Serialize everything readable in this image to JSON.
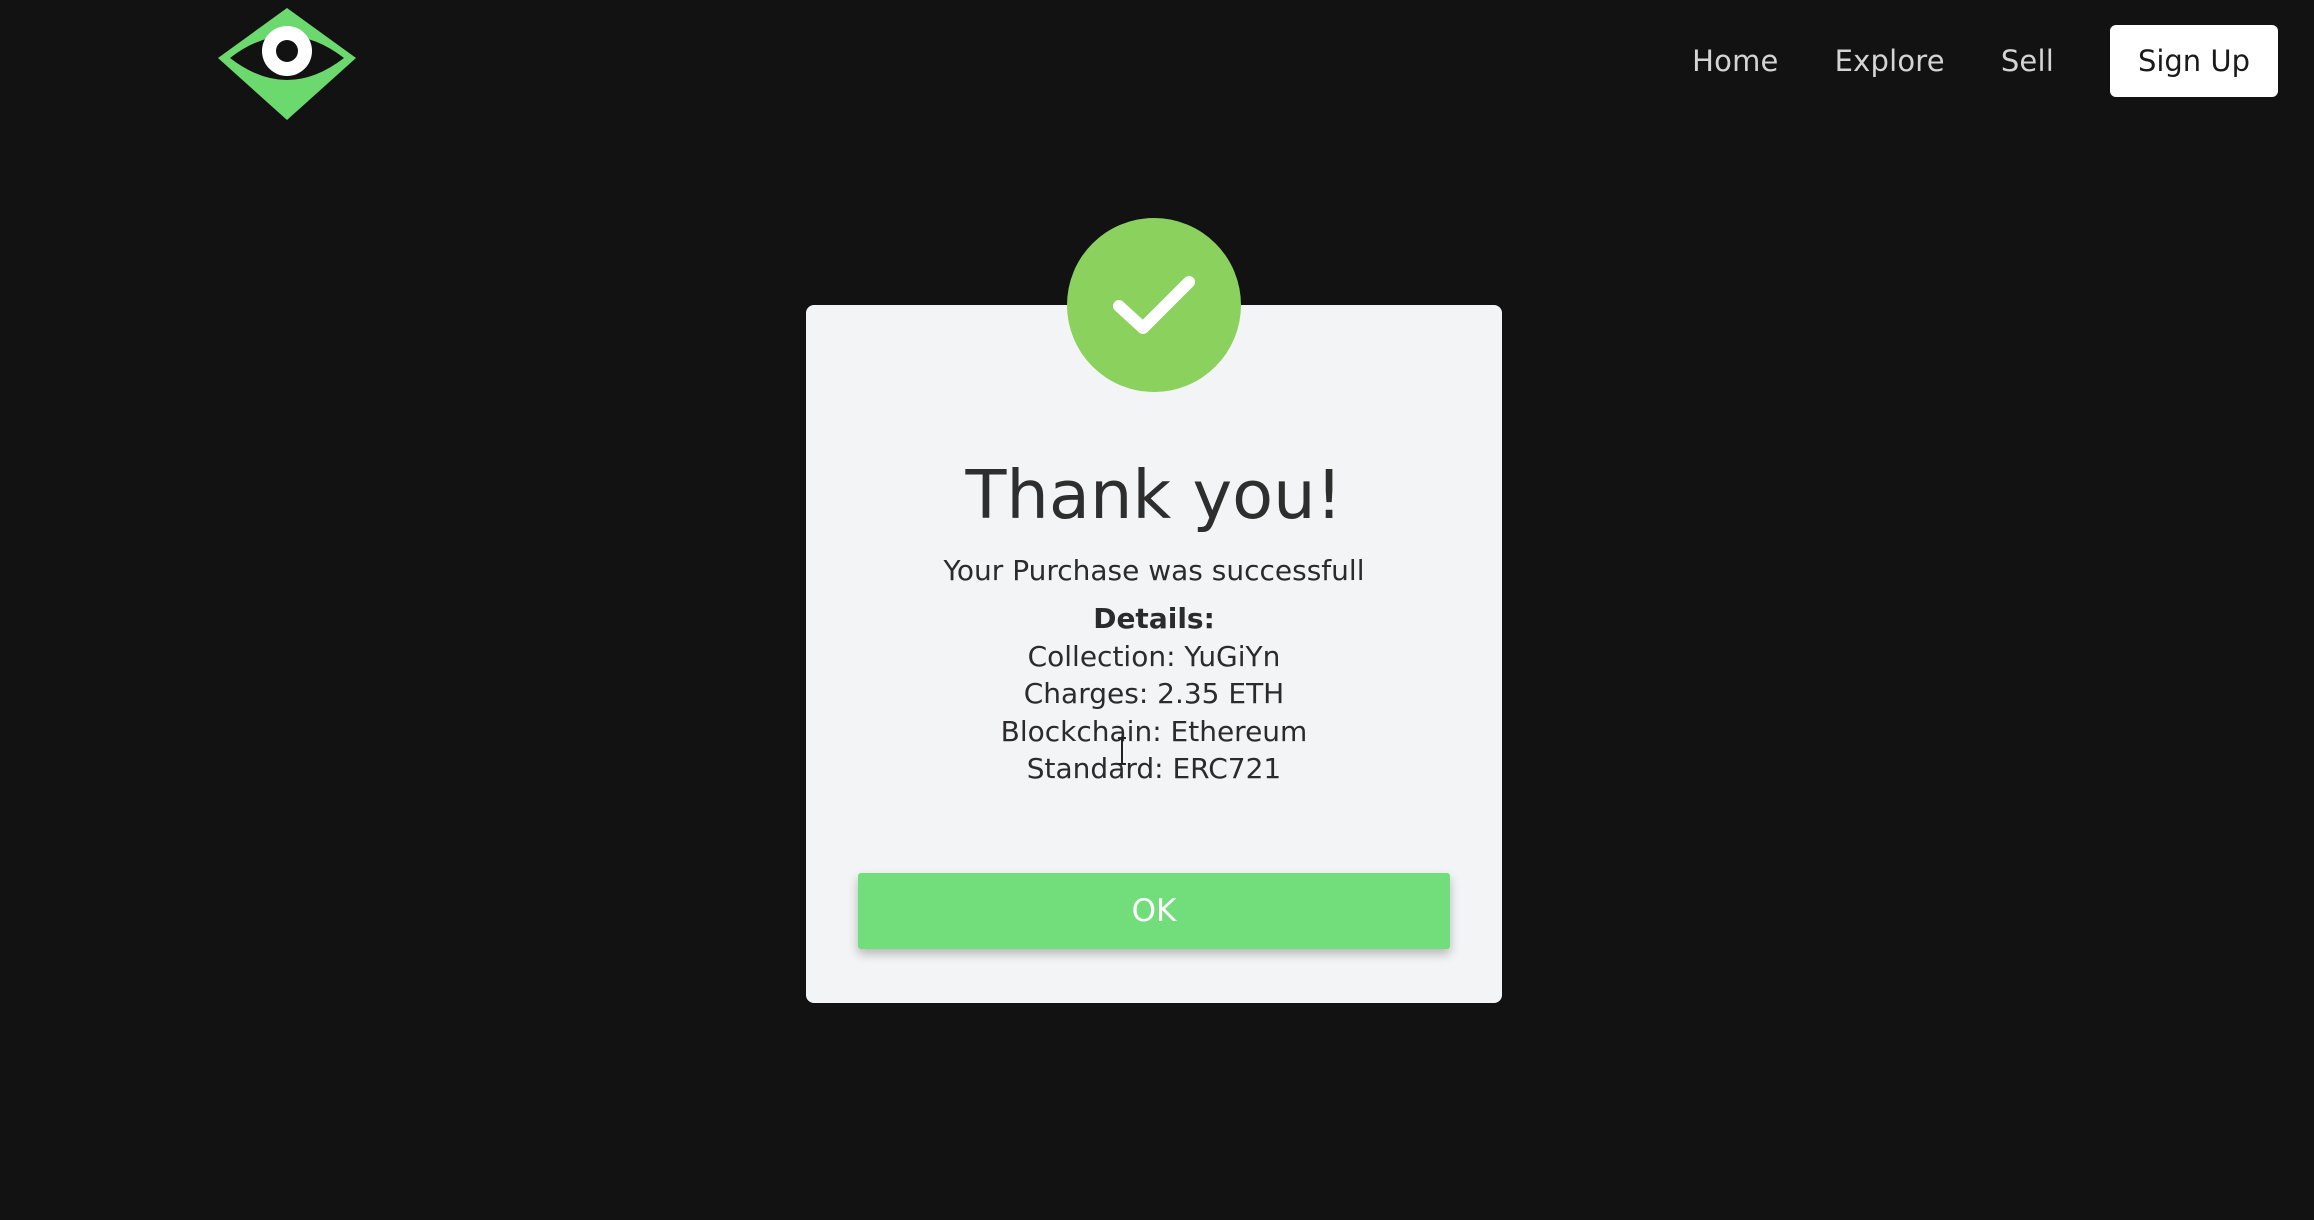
{
  "header": {
    "logo_icon": "eye-diamond-logo",
    "nav": [
      {
        "label": "Home"
      },
      {
        "label": "Explore"
      },
      {
        "label": "Sell"
      }
    ],
    "signup_label": "Sign Up"
  },
  "modal": {
    "icon": "checkmark-icon",
    "title": "Thank you!",
    "message": "Your Purchase was successfull",
    "details_heading": "Details:",
    "details": [
      "Collection: YuGiYn",
      "Charges: 2.35 ETH",
      "Blockchain: Ethereum",
      "Standard: ERC721"
    ],
    "ok_label": "OK"
  },
  "colors": {
    "background": "#121212",
    "accent_green": "#72de7b",
    "check_green": "#8bd15e",
    "card": "#f3f4f5"
  }
}
